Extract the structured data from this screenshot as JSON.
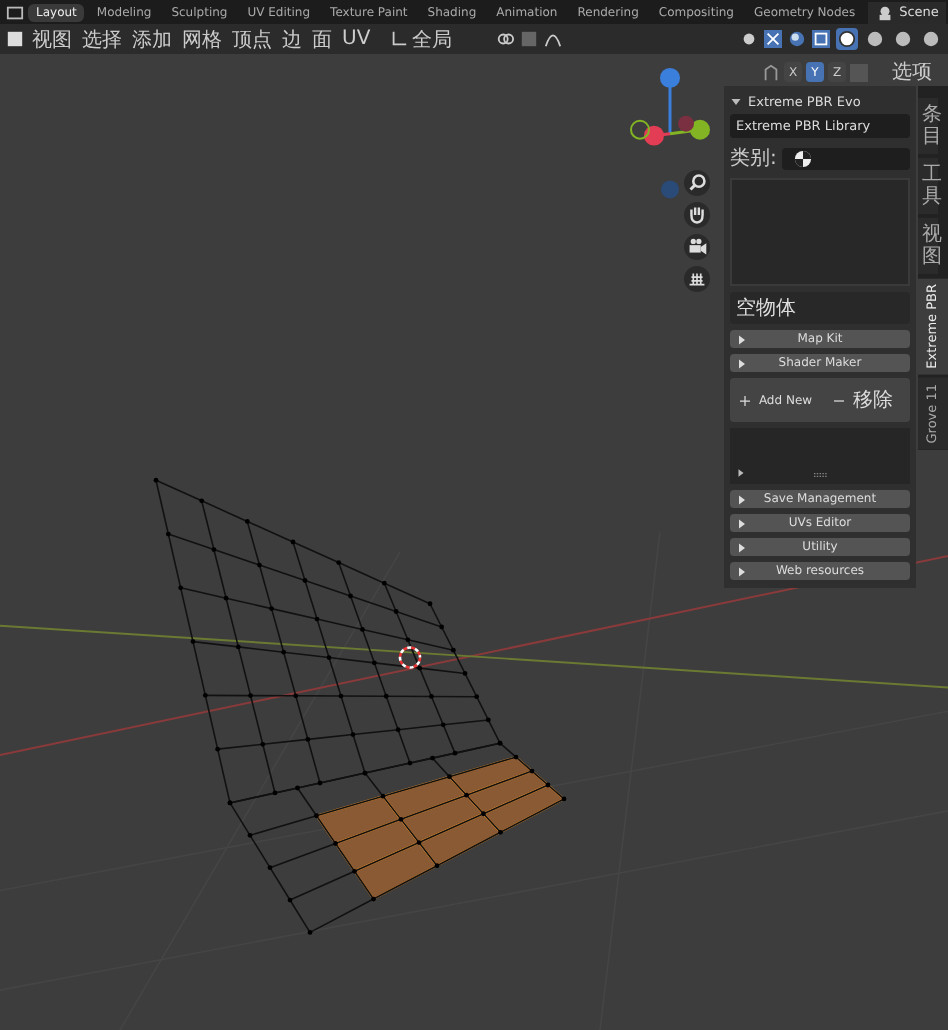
{
  "workspace_tabs": [
    {
      "label": "Layout",
      "selected": true
    },
    {
      "label": "Modeling",
      "selected": false
    },
    {
      "label": "Sculpting",
      "selected": false
    },
    {
      "label": "UV Editing",
      "selected": false
    },
    {
      "label": "Texture Paint",
      "selected": false
    },
    {
      "label": "Shading",
      "selected": false
    },
    {
      "label": "Animation",
      "selected": false
    },
    {
      "label": "Rendering",
      "selected": false
    },
    {
      "label": "Compositing",
      "selected": false
    },
    {
      "label": "Geometry Nodes",
      "selected": false
    }
  ],
  "scene": "Scene",
  "header_menu": [
    "视图",
    "选择",
    "添加",
    "网格",
    "顶点",
    "边",
    "面",
    "UV"
  ],
  "transform_orientation": "全局",
  "viewport_shading": [
    {
      "selected": true
    },
    {
      "selected": false
    },
    {
      "selected": false
    },
    {
      "selected": false
    }
  ],
  "mirror_axes": [
    {
      "label": "X",
      "on": false
    },
    {
      "label": "Y",
      "on": true
    },
    {
      "label": "Z",
      "on": false
    }
  ],
  "options_menu": "选项",
  "sidebar_tabs": [
    {
      "label": "条目",
      "selected": false
    },
    {
      "label": "工具",
      "selected": false
    },
    {
      "label": "视图",
      "selected": false
    },
    {
      "label": "Extreme PBR",
      "selected": true
    },
    {
      "label": "Grove 11",
      "selected": false
    }
  ],
  "panel": {
    "title": "Extreme PBR Evo",
    "expanded": true,
    "library": "Extreme PBR Library",
    "category_label": "类别:",
    "object_name": "空物体",
    "sections": [
      {
        "label": "Map Kit",
        "expanded": false
      },
      {
        "label": "Shader Maker",
        "expanded": false
      }
    ],
    "add_button": "Add New",
    "remove_button": "移除",
    "bottom_sections": [
      {
        "label": "Save Management",
        "expanded": false
      },
      {
        "label": "UVs Editor",
        "expanded": false
      },
      {
        "label": "Utility",
        "expanded": false
      },
      {
        "label": "Web resources",
        "expanded": false
      }
    ]
  }
}
